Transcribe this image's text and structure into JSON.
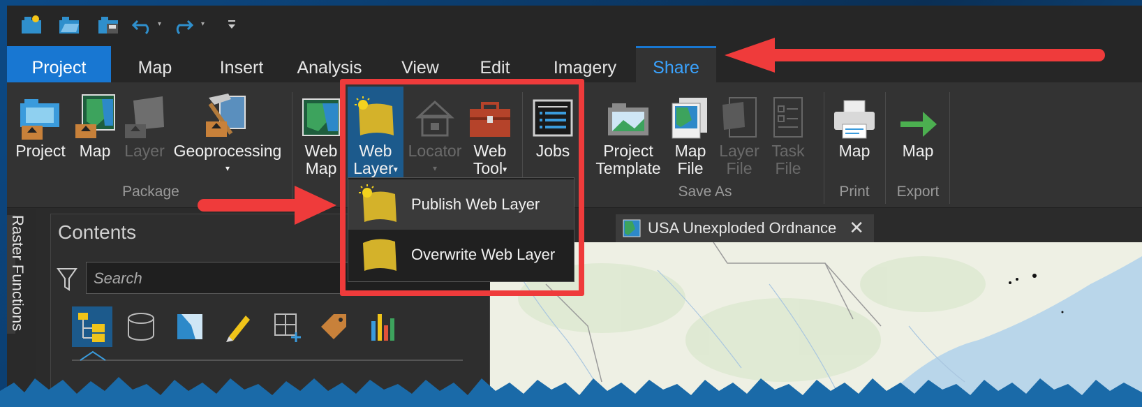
{
  "quick_access": {
    "icons": [
      "new-project-icon",
      "open-project-icon",
      "save-project-icon",
      "undo-icon",
      "redo-icon",
      "customize-toolbar-icon"
    ]
  },
  "tabs": [
    {
      "label": "Project"
    },
    {
      "label": "Map"
    },
    {
      "label": "Insert"
    },
    {
      "label": "Analysis"
    },
    {
      "label": "View"
    },
    {
      "label": "Edit"
    },
    {
      "label": "Imagery"
    },
    {
      "label": "Share"
    }
  ],
  "ribbon": {
    "package": {
      "group_label": "Package",
      "buttons": [
        {
          "label": "Project"
        },
        {
          "label": "Map"
        },
        {
          "label": "Layer",
          "disabled": true
        },
        {
          "label": "Geoprocessing"
        }
      ]
    },
    "share_as": {
      "buttons": [
        {
          "label_line1": "Web",
          "label_line2": "Map"
        },
        {
          "label_line1": "Web",
          "label_line2": "Layer"
        },
        {
          "label_line1": "Locator",
          "disabled": true
        },
        {
          "label_line1": "Web",
          "label_line2": "Tool"
        }
      ]
    },
    "status": {
      "jobs_label": "Jobs"
    },
    "save_as": {
      "group_label": "Save As",
      "buttons": [
        {
          "label_line1": "Project",
          "label_line2": "Template"
        },
        {
          "label_line1": "Map",
          "label_line2": "File"
        },
        {
          "label_line1": "Layer",
          "label_line2": "File",
          "disabled": true
        },
        {
          "label_line1": "Task",
          "label_line2": "File",
          "disabled": true
        }
      ]
    },
    "print": {
      "group_label": "Print",
      "button": "Map"
    },
    "export": {
      "group_label": "Export",
      "button": "Map"
    }
  },
  "web_layer_menu": {
    "items": [
      {
        "label": "Publish Web Layer"
      },
      {
        "label": "Overwrite Web Layer"
      }
    ]
  },
  "side_panel": {
    "label": "Raster Functions"
  },
  "contents": {
    "title": "Contents",
    "search_placeholder": "Search"
  },
  "map_tab": {
    "label": "USA Unexploded Ordnance"
  },
  "colors": {
    "accent": "#1877d2",
    "highlight": "#ef3b3b",
    "share_tab_text": "#3aa3ff"
  }
}
